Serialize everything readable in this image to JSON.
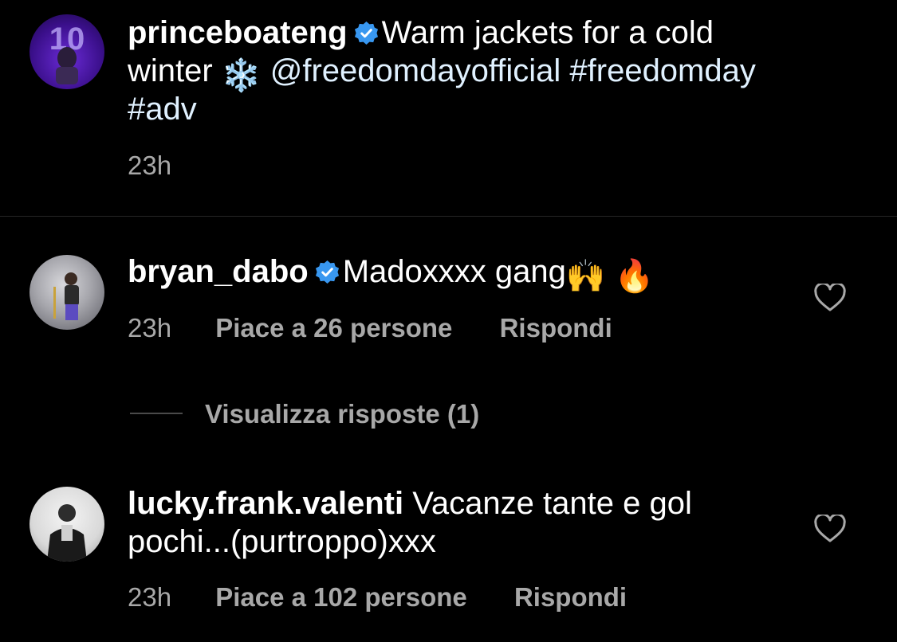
{
  "post": {
    "username": "princeboateng",
    "caption_line1": "Warm jackets for a cold",
    "caption_line2_prefix": "winter",
    "emoji_snowflake": "❄️",
    "mention": "@freedomdayofficial",
    "hashtag1": "#freedomday",
    "hashtag2": "#adv",
    "time": "23h"
  },
  "comments": [
    {
      "username": "bryan_dabo",
      "text": "Madoxxxx gang",
      "emoji1": "🙌",
      "emoji2": "🔥",
      "time": "23h",
      "likes": "Piace a 26 persone",
      "reply": "Rispondi",
      "view_replies": "Visualizza risposte (1)"
    },
    {
      "username": "lucky.frank.valenti",
      "text_line1": "Vacanze tante e gol",
      "text_line2": "pochi...(purtroppo)xxx",
      "time": "23h",
      "likes": "Piace a 102 persone",
      "reply": "Rispondi"
    }
  ],
  "icons": {
    "verified": "verified-badge-icon",
    "heart": "heart-outline-icon"
  },
  "colors": {
    "background": "#000000",
    "text": "#ffffff",
    "muted": "#a8a8a8",
    "mention": "#e0f1ff",
    "verified": "#3897f0"
  }
}
